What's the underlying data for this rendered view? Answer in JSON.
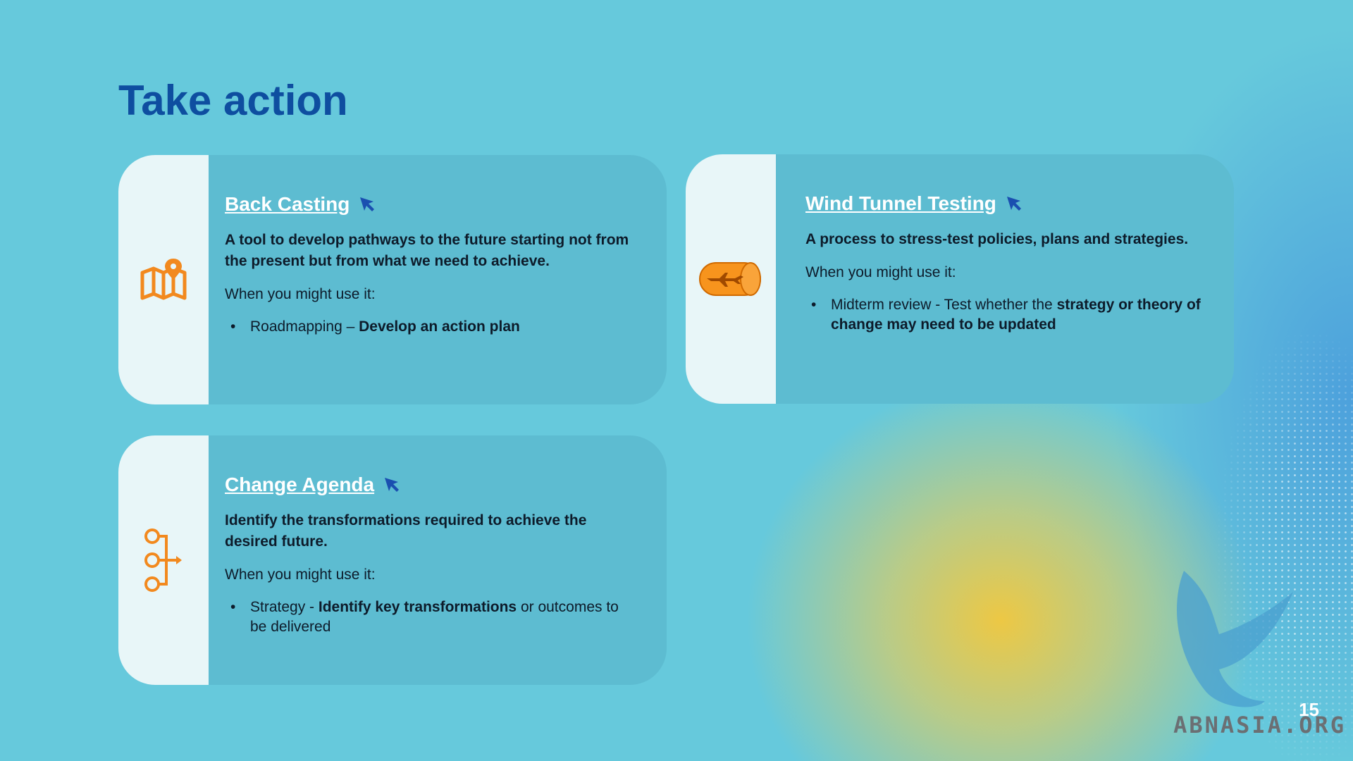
{
  "page": {
    "title": "Take action",
    "page_number": "15",
    "watermark": "ABNASIA.ORG"
  },
  "colors": {
    "background": "#66c9dc",
    "card": "#5dbcd1",
    "card_side": "#e8f6f8",
    "title": "#0e4ea0",
    "icon_orange": "#f2891e",
    "cursor_blue": "#1a4fb0"
  },
  "cards": [
    {
      "title": "Back Casting",
      "icon": "map-pin-icon",
      "description": "A tool to develop pathways to the future starting not from the present but from what we need to achieve.",
      "when_label": "When you might use it:",
      "bullet": {
        "plain": "Roadmapping – ",
        "bold": "Develop an action plan",
        "plain_after": ""
      }
    },
    {
      "title": "Wind Tunnel Testing",
      "icon": "wind-tunnel-icon",
      "description": "A process to stress-test policies, plans and strategies.",
      "when_label": "When you might use it:",
      "bullet": {
        "plain": "Midterm review - Test whether the ",
        "bold": "strategy or theory of change may need to be updated",
        "plain_after": ""
      }
    },
    {
      "title": "Change Agenda",
      "icon": "flow-nodes-icon",
      "description": "Identify the transformations required to achieve the desired future.",
      "when_label": "When you might use it:",
      "bullet": {
        "plain": "Strategy - ",
        "bold": "Identify key transformations",
        "plain_after": " or outcomes to be delivered"
      }
    }
  ]
}
